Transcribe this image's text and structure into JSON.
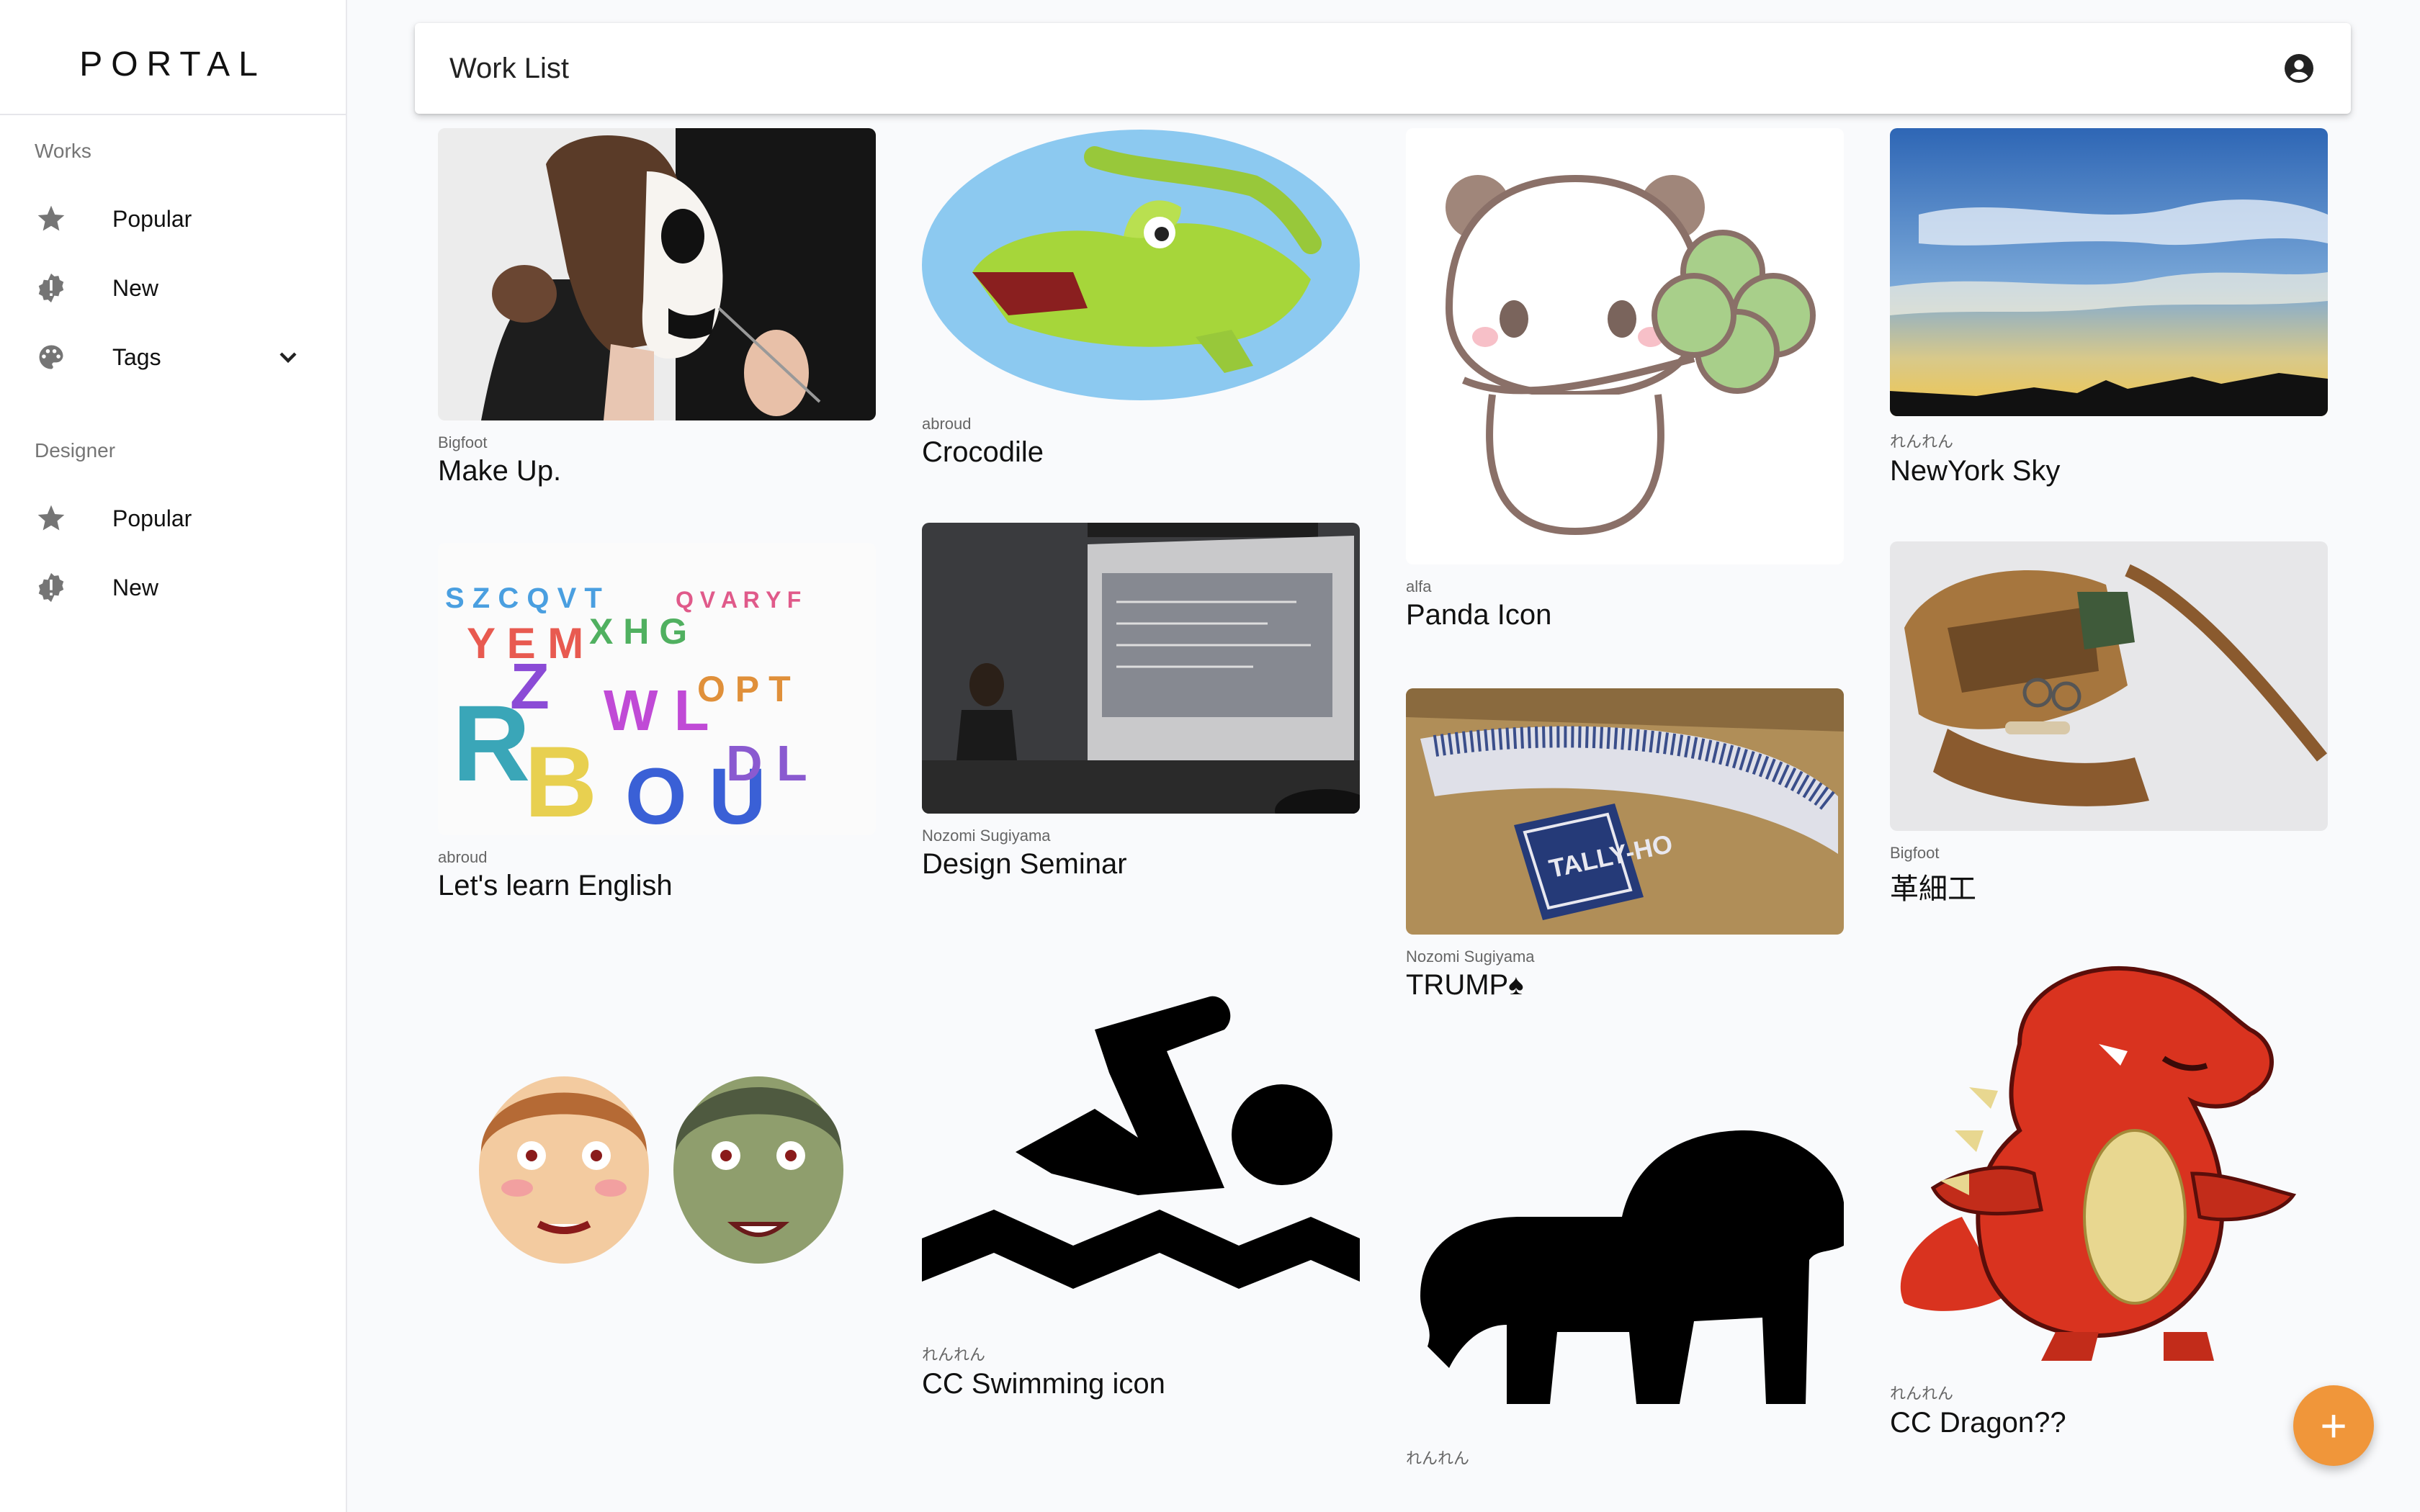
{
  "brand": "PORTAL",
  "sidebar": {
    "works_heading": "Works",
    "works_items": [
      {
        "label": "Popular",
        "icon": "star-icon"
      },
      {
        "label": "New",
        "icon": "new-badge-icon"
      },
      {
        "label": "Tags",
        "icon": "palette-icon"
      }
    ],
    "designer_heading": "Designer",
    "designer_items": [
      {
        "label": "Popular",
        "icon": "star-icon"
      },
      {
        "label": "New",
        "icon": "new-badge-icon"
      }
    ]
  },
  "appbar": {
    "title": "Work List",
    "account_icon": "account-circle-icon"
  },
  "works": [
    {
      "author": "Bigfoot",
      "title": "Make Up."
    },
    {
      "author": "abroud",
      "title": "Crocodile"
    },
    {
      "author": "alfa",
      "title": "Panda Icon"
    },
    {
      "author": "れんれん",
      "title": "NewYork Sky"
    },
    {
      "author": "abroud",
      "title": "Let's learn English"
    },
    {
      "author": "Nozomi Sugiyama",
      "title": "Design Seminar"
    },
    {
      "author": "Nozomi Sugiyama",
      "title": "TRUMP♠"
    },
    {
      "author": "Bigfoot",
      "title": "革細工"
    },
    {
      "author": "れんれん",
      "title": "CC Swimming icon"
    },
    {
      "author": "れんれん",
      "title": "CC Dragon??"
    },
    {
      "author": "れんれん",
      "title": ""
    }
  ],
  "fab": {
    "label": "+",
    "icon": "add-icon"
  },
  "colors": {
    "accent": "#f0963a",
    "sidebar_bg": "#ffffff",
    "page_bg": "#f9fafc"
  }
}
